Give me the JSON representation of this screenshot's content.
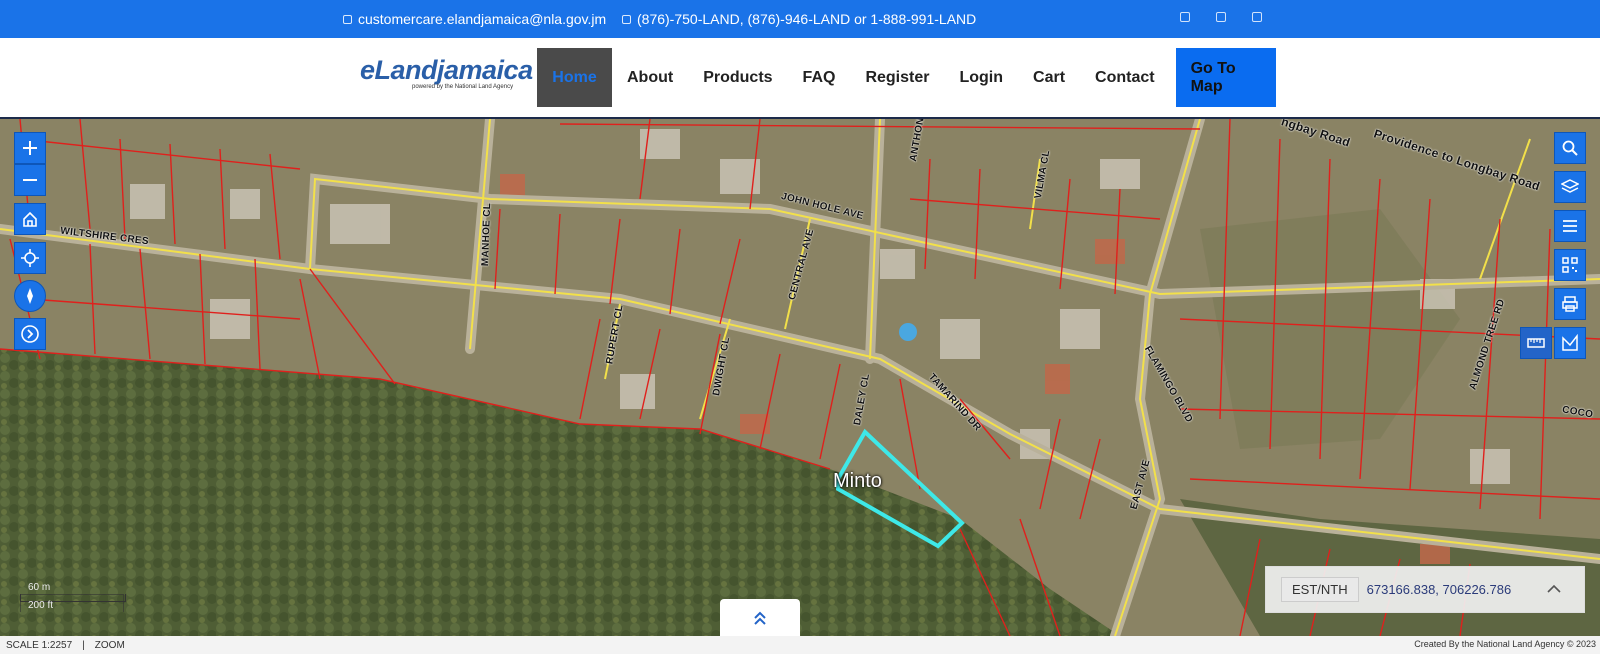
{
  "topbar": {
    "email": "customercare.elandjamaica@nla.gov.jm",
    "phone": "(876)-750-LAND, (876)-946-LAND or 1-888-991-LAND"
  },
  "logo": {
    "brand": "eLandjamaica",
    "tagline": "powered by the National Land Agency"
  },
  "nav": {
    "home": "Home",
    "about": "About",
    "products": "Products",
    "faq": "FAQ",
    "register": "Register",
    "login": "Login",
    "cart": "Cart",
    "contact": "Contact",
    "goto_map": "Go To Map"
  },
  "map": {
    "streets": {
      "wiltshire": "WILTSHIRE CRES",
      "john_hole": "JOHN HOLE AVE",
      "manhoe": "MANHOE CL",
      "central": "CENTRAL AVE",
      "rupert": "RUPERT CL",
      "dwight": "DWIGHT CL",
      "daley": "DALEY CL",
      "tamarind": "TAMARIND DR",
      "flamingo": "FLAMINGO BLVD",
      "east": "EAST AVE",
      "vilma": "VILMA CL",
      "anthon": "ANTHON",
      "almond": "ALMOND TREE RD",
      "providence": "Providence to Longbay Road",
      "longbay": "ngbay Road",
      "coco": "COCO"
    },
    "parcel_label": "Minto",
    "scale_metric": "60 m",
    "scale_imperial": "200 ft",
    "coord_label": "EST/NTH",
    "coord_value": "673166.838, 706226.786",
    "accent": "#1a73e8",
    "parcel_color": "#3ee8e8",
    "boundary_color": "#e0201c",
    "road_color": "#f2e04a"
  },
  "status": {
    "scale": "SCALE 1:2257",
    "separator": "|",
    "zoom": "ZOOM",
    "credit": "Created By the National Land Agency © 2023"
  }
}
